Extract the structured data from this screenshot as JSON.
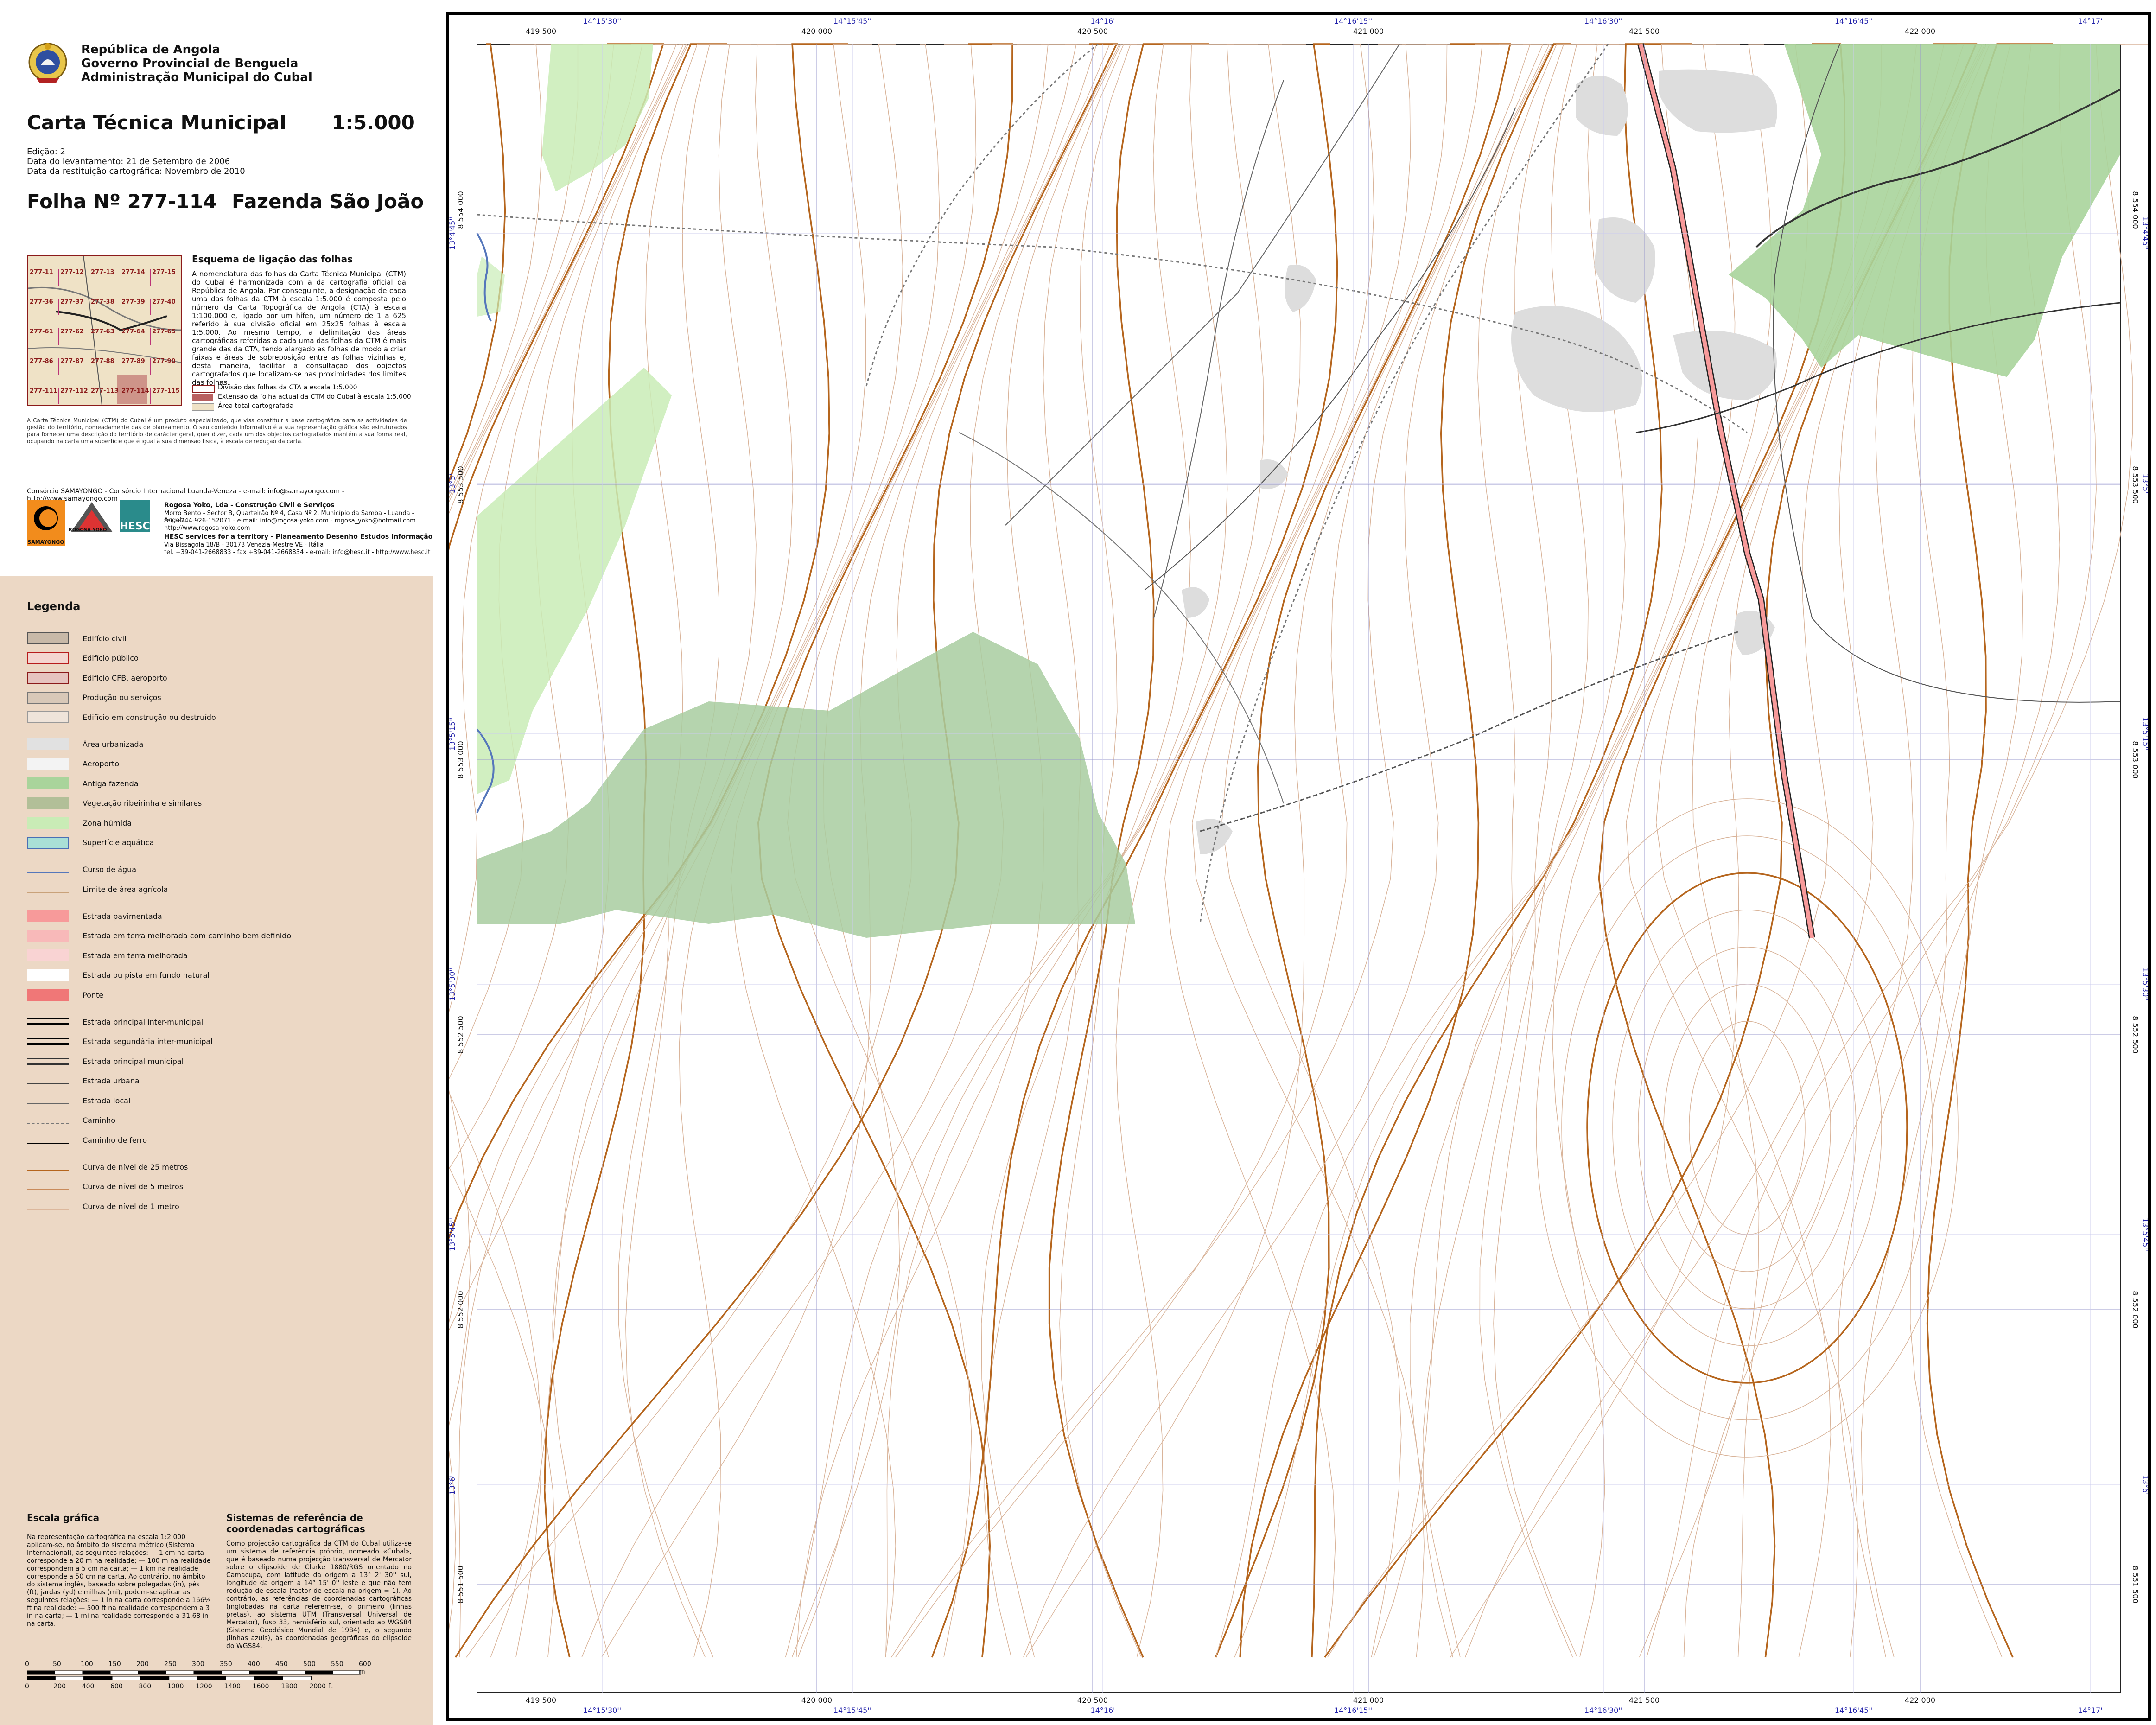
{
  "header": {
    "org_line1": "República de Angola",
    "org_line2": "Governo Provincial de Benguela",
    "org_line3": "Administração Municipal do Cubal",
    "title": "Carta Técnica Municipal",
    "scale": "1:5.000",
    "edition": "Edição: 2",
    "survey_date": "Data do levantamento: 21 de Setembro de 2006",
    "restitution_date": "Data da restituição cartográfica: Novembro de 2010",
    "sheet_label": "Folha Nº  277-114",
    "sheet_name": "Fazenda São João"
  },
  "index_map": {
    "title": "Esquema de ligação das folhas",
    "text": "A nomenclatura das folhas da Carta Técnica Municipal (CTM) do Cubal é harmonizada com a da cartografia oficial da República de Angola. Por conseguinte, a designação de cada uma das folhas da CTM à escala 1:5.000 é composta pelo número da Carta Topográfica de Angola (CTA) à escala 1:100.000 e, ligado por um hífen, um número de 1 a 625 referido à sua divisão oficial em 25x25 folhas à escala 1:5.000. Ao mesmo tempo, a delimitação das áreas cartográficas referidas a cada uma das folhas da CTM é mais grande das da CTA, tendo alargado as folhas de modo a criar faixas e áreas de sobreposição entre as folhas vizinhas e, desta maneira, facilitar a consultação dos objectos cartografados que localizam-se nas proximidades dos limites das folhas.",
    "cells": [
      "277-11",
      "277-12",
      "277-13",
      "277-14",
      "277-15",
      "277-36",
      "277-37",
      "277-38",
      "277-39",
      "277-40",
      "277-61",
      "277-62",
      "277-63",
      "277-64",
      "277-65",
      "277-86",
      "277-87",
      "277-88",
      "277-89",
      "277-90",
      "277-111",
      "277-112",
      "277-113",
      "277-114",
      "277-115"
    ],
    "key_1": "Divisão das folhas da CTA à escala 1:5.000",
    "key_2": "Extensão da folha actual da CTM do Cubal à escala 1:5.000",
    "key_3": "Área total cartografada"
  },
  "notes": {
    "note_text": "A Carta Técnica Municipal (CTM) do Cubal é um produto especializado, que visa constituir a base cartográfica para as actividades de gestão do território, nomeadamente das de planeamento. O seu conteúdo informativo é a sua representação gráfica são estruturados para fornecer uma descrição do território de carácter geral, quer dizer, cada um dos objectos cartografados mantém a sua forma real, ocupando na carta uma superfície que é igual à sua dimensão física, à escala de redução da carta.",
    "consortium": "Consórcio SAMAYONGO - Consórcio Internacional Luanda-Veneza - e-mail: info@samayongo.com - http://www.samayongo.com",
    "partner_1_name": "Rogosa Yoko, Lda - Construção Civil e Serviços",
    "partner_1_addr": "Morro Bento - Sector B, Quarteirão Nº 4, Casa Nº 2, Município da Samba - Luanda - Angola",
    "partner_1_contact": "tel. +244-926-152071 - e-mail: info@rogosa-yoko.com - rogosa_yoko@hotmail.com",
    "partner_1_web": "http://www.rogosa-yoko.com",
    "partner_2_name": "HESC services for a territory - Planeamento Desenho Estudos Informação",
    "partner_2_addr": "Via Bissagola 18/B - 30173 Venezia-Mestre VE - Itália",
    "partner_2_contact": "tel. +39-041-2668833 - fax +39-041-2668834 - e-mail: info@hesc.it - http://www.hesc.it",
    "logo_1": "SAMAYONGO",
    "logo_2": "ROGOSA YOKO",
    "logo_3": "HESC"
  },
  "legend": {
    "title": "Legenda",
    "items": [
      {
        "label": "Edifício civil",
        "fill": "#c8b9a8",
        "stroke": "#555555"
      },
      {
        "label": "Edifício público",
        "fill": "#f4d6d0",
        "stroke": "#b71c1c"
      },
      {
        "label": "Edifício CFB, aeroporto",
        "fill": "#e6c4bf",
        "stroke": "#8b1a1a"
      },
      {
        "label": "Produção ou serviços",
        "fill": "#d8c8b8",
        "stroke": "#777777"
      },
      {
        "label": "Edifício em construção ou destruído",
        "fill": "#efe4da",
        "stroke": "#999999"
      },
      {
        "label": "Área urbanizada",
        "fill": "#e1e1e1",
        "stroke": "none"
      },
      {
        "label": "Aeroporto",
        "fill": "#f3f3f3",
        "stroke": "none"
      },
      {
        "label": "Antiga fazenda",
        "fill": "#a9d49b",
        "stroke": "none"
      },
      {
        "label": "Vegetação ribeirinha e similares",
        "fill": "#b2bf98",
        "stroke": "none"
      },
      {
        "label": "Zona húmida",
        "fill": "#c9ecb6",
        "stroke": "none"
      },
      {
        "label": "Superfície aquática",
        "fill": "#a9dfd6",
        "stroke": "#4a6fb5"
      },
      {
        "label": "Curso de água",
        "fill": "line",
        "stroke": "#5577bb"
      },
      {
        "label": "Limite de área agrícola",
        "fill": "line",
        "stroke": "#c9a27a"
      },
      {
        "label": "Estrada pavimentada",
        "fill": "#f79a9a",
        "stroke": "none"
      },
      {
        "label": "Estrada em terra melhorada com caminho bem definido",
        "fill": "#f8b9b9",
        "stroke": "none"
      },
      {
        "label": "Estrada em terra melhorada",
        "fill": "#f9d3d3",
        "stroke": "none"
      },
      {
        "label": "Estrada ou pista em fundo natural",
        "fill": "#ffffff",
        "stroke": "none"
      },
      {
        "label": "Ponte",
        "fill": "#f07777",
        "stroke": "none"
      },
      {
        "label": "Estrada principal inter-municipal",
        "fill": "line3",
        "stroke": "#000000"
      },
      {
        "label": "Estrada segundária inter-municipal",
        "fill": "line2",
        "stroke": "#000000"
      },
      {
        "label": "Estrada principal municipal",
        "fill": "line2",
        "stroke": "#333333"
      },
      {
        "label": "Estrada urbana",
        "fill": "line",
        "stroke": "#444444"
      },
      {
        "label": "Estrada local",
        "fill": "line",
        "stroke": "#666666"
      },
      {
        "label": "Caminho",
        "fill": "dash",
        "stroke": "#777777"
      },
      {
        "label": "Caminho de ferro",
        "fill": "line",
        "stroke": "#000000"
      },
      {
        "label": "Curva de nível de 25 metros",
        "fill": "line",
        "stroke": "#b5651d"
      },
      {
        "label": "Curva de nível de 5 metros",
        "fill": "line",
        "stroke": "#c98a5a"
      },
      {
        "label": "Curva de nível de 1 metro",
        "fill": "line",
        "stroke": "#dcb79c"
      }
    ]
  },
  "scale_section": {
    "title": "Escala gráfica",
    "text": "Na representação cartográfica na escala 1:2.000 aplicam-se, no âmbito do sistema métrico (Sistema Internacional), as seguintes relações: — 1 cm na carta corresponde a 20 m na realidade; — 100 m na realidade correspondem a 5 cm na carta; — 1 km na realidade corresponde a 50 cm na carta. Ao contrário, no âmbito do sistema inglês, baseado sobre polegadas (in), pés (ft), jardas (yd) e milhas (mi), podem-se aplicar as seguintes relações: — 1 in na carta corresponde a 166⅔ ft na realidade; — 500 ft na realidade correspondem a 3 in na carta; — 1 mi na realidade corresponde a 31,68 in na carta.",
    "metric_ticks": [
      "0",
      "50",
      "100",
      "150",
      "200",
      "250",
      "300",
      "350",
      "400",
      "450",
      "500",
      "550",
      "600 m"
    ],
    "imperial_ticks": [
      "0",
      "200",
      "400",
      "600",
      "800",
      "1000",
      "1200",
      "1400",
      "1600",
      "1800",
      "2000 ft"
    ]
  },
  "crs_section": {
    "title": "Sistemas de referência de coordenadas cartográficas",
    "text": "Como projecção cartográfica da CTM do Cubal utiliza-se um sistema de referência próprio, nomeado «Cubal», que é baseado numa projecção transversal de Mercator sobre o elipsoide de Clarke 1880/RGS orientado no Camacupa, com latitude da origem a 13° 2' 30'' sul, longitude da origem a 14° 15' 0'' leste e que não tem redução de escala (factor de escala na origem = 1). Ao contrário, as referências de coordenadas cartográficas (inglobadas na carta referem-se, o primeiro (linhas pretas), ao sistema UTM (Transversal Universal de Mercator), fuso 33, hemisfério sul, orientado ao WGS84 (Sistema Geodésico Mundial de 1984) e, o segundo (linhas azuis), às coordenadas geográficas do elipsoide do WGS84."
  },
  "map": {
    "top_easting": [
      "419 500",
      "420 000",
      "420 500",
      "421 000",
      "421 500",
      "422 000"
    ],
    "top_lon": [
      "14°15'30''",
      "14°15'45''",
      "14°16'",
      "14°16'15''",
      "14°16'30''",
      "14°16'45''",
      "14°17'"
    ],
    "left_northing": [
      "8 554 000",
      "8 553 500",
      "8 553 000",
      "8 552 500",
      "8 552 000",
      "8 551 500"
    ],
    "left_lat": [
      "13°4'45''",
      "13°5'",
      "13°5'15''",
      "13°5'30''",
      "13°5'45''",
      "13°6'"
    ],
    "bottom_easting": [
      "419 500",
      "420 000",
      "420 500",
      "421 000",
      "421 500",
      "422 000"
    ],
    "bottom_lon": [
      "14°15'30''",
      "14°15'45''",
      "14°16'",
      "14°16'15''",
      "14°16'30''",
      "14°16'45''",
      "14°17'"
    ],
    "right_northing": [
      "8 554 000",
      "8 553 500",
      "8 553 000",
      "8 552 500",
      "8 552 000",
      "8 551 500"
    ],
    "right_lat": [
      "13°4'45''",
      "13°5'",
      "13°5'15''",
      "13°5'30''",
      "13°5'45''",
      "13°6'"
    ],
    "colors": {
      "contour_major": "#b5651d",
      "contour_minor": "#d9b49a",
      "grid_utm": "#9999cc",
      "farm": "#a9d49b",
      "riparian": "#a8cda0",
      "wetland": "#c9ecb6",
      "urban": "#dddddd",
      "road_paved": "#f79a9a",
      "water": "#a9c7e8"
    }
  }
}
